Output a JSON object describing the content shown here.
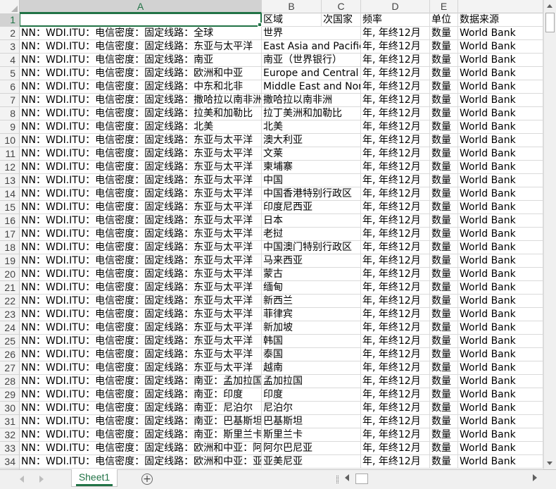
{
  "columns": [
    "A",
    "B",
    "C",
    "D",
    "E",
    ""
  ],
  "header_row": {
    "row_number": "1",
    "a": "",
    "b": "区域",
    "c": "次国家",
    "d": "频率",
    "e": "单位",
    "f": "数据来源"
  },
  "rows": [
    {
      "n": "2",
      "a": "NN：WDI.ITU：电信密度：固定线路：全球",
      "b": "世界",
      "d": "年, 年终12月",
      "e": "数量",
      "f": "World Bank"
    },
    {
      "n": "3",
      "a": "NN：WDI.ITU：电信密度：固定线路：东亚与太平洋",
      "b": "East Asia and Pacific",
      "d": "年, 年终12月",
      "e": "数量",
      "f": "World Bank"
    },
    {
      "n": "4",
      "a": "NN：WDI.ITU：电信密度：固定线路：南亚",
      "b": "南亚（世界银行）",
      "d": "年, 年终12月",
      "e": "数量",
      "f": "World Bank"
    },
    {
      "n": "5",
      "a": "NN：WDI.ITU：电信密度：固定线路：欧洲和中亚",
      "b": "Europe and Central A",
      "d": "年, 年终12月",
      "e": "数量",
      "f": "World Bank"
    },
    {
      "n": "6",
      "a": "NN：WDI.ITU：电信密度：固定线路：中东和北非",
      "b": "Middle East and Nort",
      "d": "年, 年终12月",
      "e": "数量",
      "f": "World Bank"
    },
    {
      "n": "7",
      "a": "NN：WDI.ITU：电信密度：固定线路：撒哈拉以南非洲",
      "b": "撒哈拉以南非洲",
      "d": "年, 年终12月",
      "e": "数量",
      "f": "World Bank"
    },
    {
      "n": "8",
      "a": "NN：WDI.ITU：电信密度：固定线路：拉美和加勒比",
      "b": "拉丁美洲和加勒比",
      "d": "年, 年终12月",
      "e": "数量",
      "f": "World Bank"
    },
    {
      "n": "9",
      "a": "NN：WDI.ITU：电信密度：固定线路：北美",
      "b": "北美",
      "d": "年, 年终12月",
      "e": "数量",
      "f": "World Bank"
    },
    {
      "n": "10",
      "a": "NN：WDI.ITU：电信密度：固定线路：东亚与太平洋",
      "b": "澳大利亚",
      "d": "年, 年终12月",
      "e": "数量",
      "f": "World Bank"
    },
    {
      "n": "11",
      "a": "NN：WDI.ITU：电信密度：固定线路：东亚与太平洋",
      "b": "文莱",
      "d": "年, 年终12月",
      "e": "数量",
      "f": "World Bank"
    },
    {
      "n": "12",
      "a": "NN：WDI.ITU：电信密度：固定线路：东亚与太平洋",
      "b": "柬埔寨",
      "d": "年, 年终12月",
      "e": "数量",
      "f": "World Bank"
    },
    {
      "n": "13",
      "a": "NN：WDI.ITU：电信密度：固定线路：东亚与太平洋",
      "b": "中国",
      "d": "年, 年终12月",
      "e": "数量",
      "f": "World Bank"
    },
    {
      "n": "14",
      "a": "NN：WDI.ITU：电信密度：固定线路：东亚与太平洋",
      "b": "中国香港特别行政区",
      "d": "年, 年终12月",
      "e": "数量",
      "f": "World Bank"
    },
    {
      "n": "15",
      "a": "NN：WDI.ITU：电信密度：固定线路：东亚与太平洋",
      "b": "印度尼西亚",
      "d": "年, 年终12月",
      "e": "数量",
      "f": "World Bank"
    },
    {
      "n": "16",
      "a": "NN：WDI.ITU：电信密度：固定线路：东亚与太平洋",
      "b": "日本",
      "d": "年, 年终12月",
      "e": "数量",
      "f": "World Bank"
    },
    {
      "n": "17",
      "a": "NN：WDI.ITU：电信密度：固定线路：东亚与太平洋",
      "b": "老挝",
      "d": "年, 年终12月",
      "e": "数量",
      "f": "World Bank"
    },
    {
      "n": "18",
      "a": "NN：WDI.ITU：电信密度：固定线路：东亚与太平洋",
      "b": "中国澳门特别行政区",
      "d": "年, 年终12月",
      "e": "数量",
      "f": "World Bank"
    },
    {
      "n": "19",
      "a": "NN：WDI.ITU：电信密度：固定线路：东亚与太平洋",
      "b": "马来西亚",
      "d": "年, 年终12月",
      "e": "数量",
      "f": "World Bank"
    },
    {
      "n": "20",
      "a": "NN：WDI.ITU：电信密度：固定线路：东亚与太平洋",
      "b": "蒙古",
      "d": "年, 年终12月",
      "e": "数量",
      "f": "World Bank"
    },
    {
      "n": "21",
      "a": "NN：WDI.ITU：电信密度：固定线路：东亚与太平洋",
      "b": "缅甸",
      "d": "年, 年终12月",
      "e": "数量",
      "f": "World Bank"
    },
    {
      "n": "22",
      "a": "NN：WDI.ITU：电信密度：固定线路：东亚与太平洋",
      "b": "新西兰",
      "d": "年, 年终12月",
      "e": "数量",
      "f": "World Bank"
    },
    {
      "n": "23",
      "a": "NN：WDI.ITU：电信密度：固定线路：东亚与太平洋",
      "b": "菲律宾",
      "d": "年, 年终12月",
      "e": "数量",
      "f": "World Bank"
    },
    {
      "n": "24",
      "a": "NN：WDI.ITU：电信密度：固定线路：东亚与太平洋",
      "b": "新加坡",
      "d": "年, 年终12月",
      "e": "数量",
      "f": "World Bank"
    },
    {
      "n": "25",
      "a": "NN：WDI.ITU：电信密度：固定线路：东亚与太平洋",
      "b": "韩国",
      "d": "年, 年终12月",
      "e": "数量",
      "f": "World Bank"
    },
    {
      "n": "26",
      "a": "NN：WDI.ITU：电信密度：固定线路：东亚与太平洋",
      "b": "泰国",
      "d": "年, 年终12月",
      "e": "数量",
      "f": "World Bank"
    },
    {
      "n": "27",
      "a": "NN：WDI.ITU：电信密度：固定线路：东亚与太平洋",
      "b": "越南",
      "d": "年, 年终12月",
      "e": "数量",
      "f": "World Bank"
    },
    {
      "n": "28",
      "a": "NN：WDI.ITU：电信密度：固定线路：南亚：孟加拉国",
      "b": "孟加拉国",
      "d": "年, 年终12月",
      "e": "数量",
      "f": "World Bank"
    },
    {
      "n": "29",
      "a": "NN：WDI.ITU：电信密度：固定线路：南亚：印度",
      "b": "印度",
      "d": "年, 年终12月",
      "e": "数量",
      "f": "World Bank"
    },
    {
      "n": "30",
      "a": "NN：WDI.ITU：电信密度：固定线路：南亚：尼泊尔",
      "b": "尼泊尔",
      "d": "年, 年终12月",
      "e": "数量",
      "f": "World Bank"
    },
    {
      "n": "31",
      "a": "NN：WDI.ITU：电信密度：固定线路：南亚：巴基斯坦",
      "b": "巴基斯坦",
      "d": "年, 年终12月",
      "e": "数量",
      "f": "World Bank"
    },
    {
      "n": "32",
      "a": "NN：WDI.ITU：电信密度：固定线路：南亚：斯里兰卡",
      "b": "斯里兰卡",
      "d": "年, 年终12月",
      "e": "数量",
      "f": "World Bank"
    },
    {
      "n": "33",
      "a": "NN：WDI.ITU：电信密度：固定线路：欧洲和中亚：阿尔巴尼亚",
      "b": "阿尔巴尼亚",
      "d": "年, 年终12月",
      "e": "数量",
      "f": "World Bank"
    },
    {
      "n": "34",
      "a": "NN：WDI.ITU：电信密度：固定线路：欧洲和中亚：亚美尼亚",
      "b": "亚美尼亚",
      "d": "年, 年终12月",
      "e": "数量",
      "f": "World Bank"
    }
  ],
  "sheet_tabs": [
    {
      "label": "Sheet1"
    }
  ],
  "add_sheet_label": "+",
  "accent_color": "#217346"
}
